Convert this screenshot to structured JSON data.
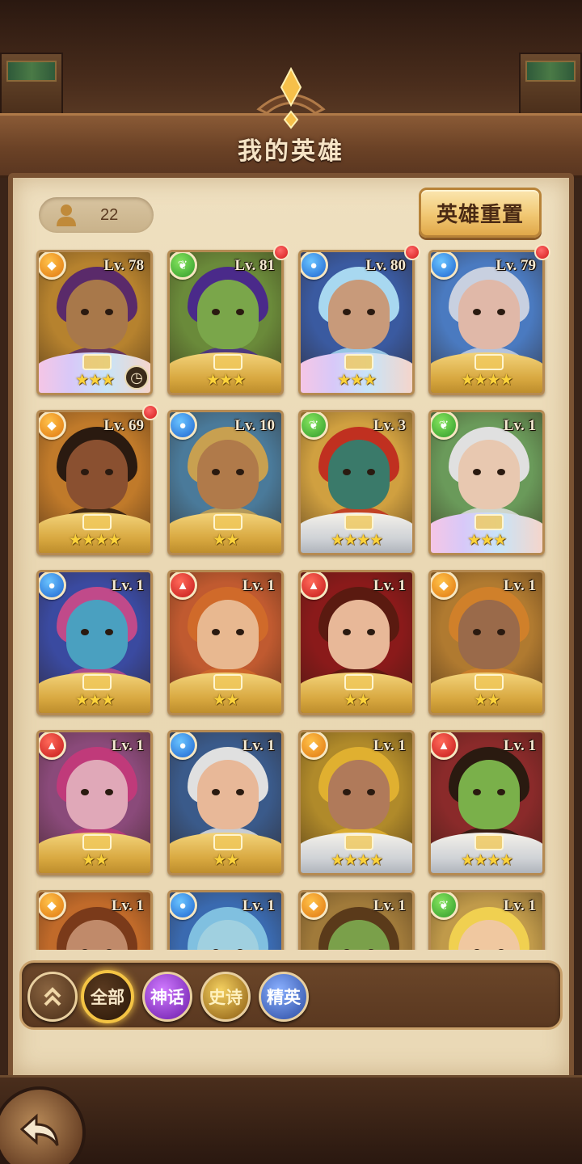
{
  "header": {
    "title": "我的英雄"
  },
  "hero_count": {
    "value": "22"
  },
  "reset_button": {
    "label": "英雄重置"
  },
  "heroes": [
    {
      "level": "Lv. 78",
      "element": "earth",
      "stars": "★★★",
      "frame": "rainbow",
      "bg": "#b6822e",
      "skin": "#a8784a",
      "hair": "#5a2a6a",
      "red_dot": false,
      "clock": true
    },
    {
      "level": "Lv. 81",
      "element": "wind",
      "stars": "★★★",
      "frame": "gold",
      "bg": "#6a8a3a",
      "skin": "#7aa64a",
      "hair": "#4a2a8a",
      "red_dot": true,
      "clock": false
    },
    {
      "level": "Lv. 80",
      "element": "water",
      "stars": "★★★",
      "frame": "rainbow",
      "bg": "#3a5aa0",
      "skin": "#c89a7a",
      "hair": "#a8d8f0",
      "red_dot": true,
      "clock": false
    },
    {
      "level": "Lv. 79",
      "element": "water",
      "stars": "★★★★",
      "frame": "gold",
      "bg": "#4a7ac0",
      "skin": "#e0b8a8",
      "hair": "#c8d0e0",
      "red_dot": true,
      "clock": false
    },
    {
      "level": "Lv. 69",
      "element": "earth",
      "stars": "★★★★",
      "frame": "gold",
      "bg": "#c07a2a",
      "skin": "#8a5030",
      "hair": "#2a1a10",
      "red_dot": true,
      "clock": false
    },
    {
      "level": "Lv. 10",
      "element": "water",
      "stars": "★★",
      "frame": "gold",
      "bg": "#4a7a9a",
      "skin": "#b07a4a",
      "hair": "#c8a050",
      "red_dot": false,
      "clock": false
    },
    {
      "level": "Lv. 3",
      "element": "wind",
      "stars": "★★★★",
      "frame": "silver",
      "bg": "#d0a040",
      "skin": "#3a7a6a",
      "hair": "#c03020",
      "red_dot": false,
      "clock": false
    },
    {
      "level": "Lv. 1",
      "element": "wind",
      "stars": "★★★",
      "frame": "rainbow",
      "bg": "#6a9a5a",
      "skin": "#e8c8b0",
      "hair": "#e0e0e0",
      "red_dot": false,
      "clock": false
    },
    {
      "level": "Lv. 1",
      "element": "water",
      "stars": "★★★",
      "frame": "gold",
      "bg": "#3a4aa0",
      "skin": "#4aa0c0",
      "hair": "#c04a8a",
      "red_dot": false,
      "clock": false
    },
    {
      "level": "Lv. 1",
      "element": "fire",
      "stars": "★★",
      "frame": "gold",
      "bg": "#c05a30",
      "skin": "#e8b890",
      "hair": "#d06a2a",
      "red_dot": false,
      "clock": false
    },
    {
      "level": "Lv. 1",
      "element": "fire",
      "stars": "★★",
      "frame": "gold",
      "bg": "#8a1a1a",
      "skin": "#e8b898",
      "hair": "#5a1a10",
      "red_dot": false,
      "clock": false
    },
    {
      "level": "Lv. 1",
      "element": "earth",
      "stars": "★★",
      "frame": "gold",
      "bg": "#b07a30",
      "skin": "#9a6a4a",
      "hair": "#d0802a",
      "red_dot": false,
      "clock": false
    },
    {
      "level": "Lv. 1",
      "element": "fire",
      "stars": "★★",
      "frame": "gold",
      "bg": "#8a4a7a",
      "skin": "#e0a8b8",
      "hair": "#c03a7a",
      "red_dot": false,
      "clock": false
    },
    {
      "level": "Lv. 1",
      "element": "water",
      "stars": "★★",
      "frame": "gold",
      "bg": "#3a5a8a",
      "skin": "#e8b898",
      "hair": "#e0e0e0",
      "red_dot": false,
      "clock": false
    },
    {
      "level": "Lv. 1",
      "element": "earth",
      "stars": "★★★★",
      "frame": "silver",
      "bg": "#b08a2a",
      "skin": "#b07a5a",
      "hair": "#e0b030",
      "red_dot": false,
      "clock": false
    },
    {
      "level": "Lv. 1",
      "element": "fire",
      "stars": "★★★★",
      "frame": "silver",
      "bg": "#8a2a2a",
      "skin": "#7ab04a",
      "hair": "#2a1a10",
      "red_dot": false,
      "clock": false
    },
    {
      "level": "Lv. 1",
      "element": "earth",
      "stars": "",
      "frame": "none",
      "bg": "#c06a2a",
      "skin": "#c08a6a",
      "hair": "#7a3a1a",
      "red_dot": false,
      "clock": false
    },
    {
      "level": "Lv. 1",
      "element": "water",
      "stars": "",
      "frame": "none",
      "bg": "#3a6ab0",
      "skin": "#a0d0e0",
      "hair": "#80c0e0",
      "red_dot": false,
      "clock": false
    },
    {
      "level": "Lv. 1",
      "element": "earth",
      "stars": "",
      "frame": "none",
      "bg": "#a07a3a",
      "skin": "#7aa04a",
      "hair": "#5a3a1a",
      "red_dot": false,
      "clock": false
    },
    {
      "level": "Lv. 1",
      "element": "wind",
      "stars": "",
      "frame": "none",
      "bg": "#c09a4a",
      "skin": "#f0c8a0",
      "hair": "#f0d050",
      "red_dot": false,
      "clock": false
    }
  ],
  "element_icons": {
    "earth": "diamond-icon",
    "wind": "leaf-icon",
    "water": "droplet-icon",
    "fire": "flame-icon"
  },
  "filters": {
    "collapse_icon": "double-chevron-up-icon",
    "all": "全部",
    "myth": "神话",
    "epic": "史诗",
    "elite": "精英"
  },
  "back_icon": "return-arrow-icon"
}
